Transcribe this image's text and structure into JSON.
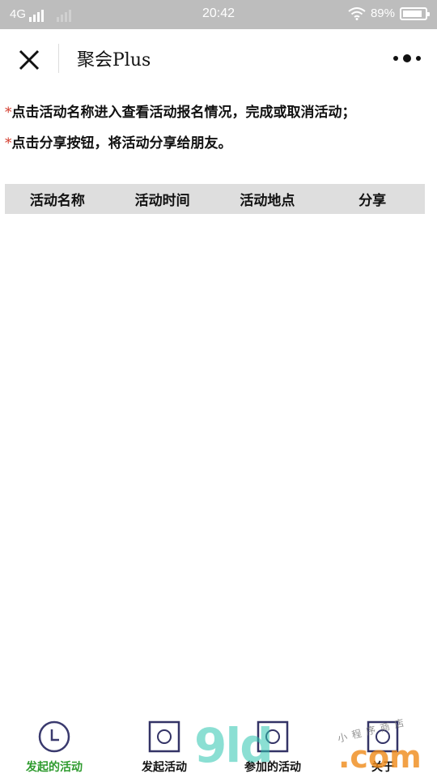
{
  "status_bar": {
    "network": "4G",
    "time": "20:42",
    "battery_percent": "89%",
    "battery_level": 0.89
  },
  "nav": {
    "title": "聚会Plus",
    "close_icon": "close-icon",
    "more_icon": "more-icon"
  },
  "tips": [
    {
      "marker": "*",
      "text": "点击活动名称进入查看活动报名情况，完成或取消活动；"
    },
    {
      "marker": "*",
      "text": "点击分享按钮，将活动分享给朋友。"
    }
  ],
  "table": {
    "columns": [
      "活动名称",
      "活动时间",
      "活动地点",
      "分享"
    ],
    "rows": []
  },
  "tabs": [
    {
      "label": "发起的活动",
      "icon": "clock-icon",
      "active": true
    },
    {
      "label": "发起活动",
      "icon": "square-circle-icon",
      "active": false
    },
    {
      "label": "参加的活动",
      "icon": "square-circle-icon",
      "active": false
    },
    {
      "label": "关于",
      "icon": "square-circle-icon",
      "active": false
    }
  ],
  "watermark": {
    "brand": "9ld",
    "tld": ".com",
    "tagline": "小程序商店"
  },
  "colors": {
    "status_bar_bg": "#bdbdbd",
    "active_tab": "#2e9b2e",
    "tip_marker": "#d33b2c",
    "table_header_bg": "#dedede"
  }
}
